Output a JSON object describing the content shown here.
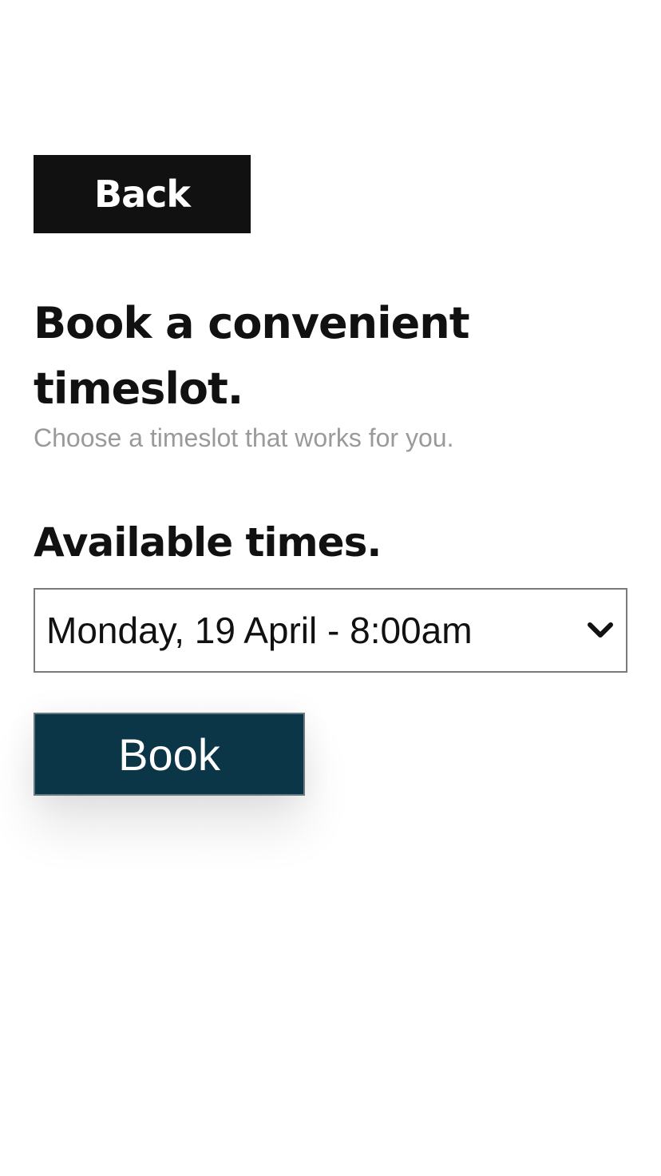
{
  "header": {
    "back_label": "Back"
  },
  "main": {
    "title": "Book a convenient timeslot.",
    "subtitle": "Choose a timeslot that works for you.",
    "available_heading": "Available times.",
    "time_select": {
      "selected_value": "Monday, 19 April - 8:00am",
      "icon": "chevron-down-icon"
    },
    "book_label": "Book"
  },
  "colors": {
    "back_button_bg": "#111111",
    "book_button_bg": "#0a3647",
    "subtitle_text": "#9a9a9a"
  }
}
